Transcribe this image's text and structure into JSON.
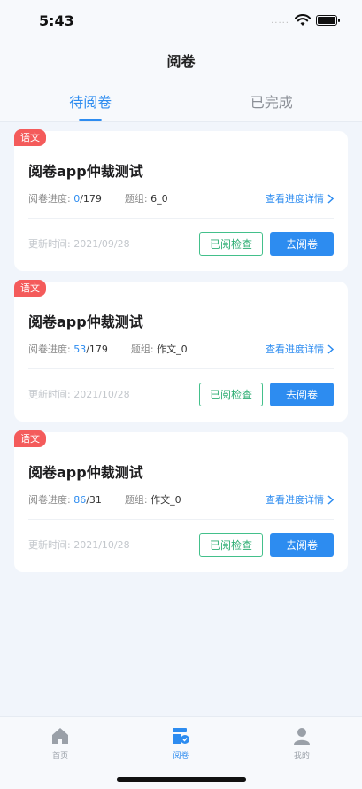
{
  "status_bar": {
    "time": "5:43",
    "signal": "....."
  },
  "nav": {
    "title": "阅卷"
  },
  "tabs": [
    {
      "label": "待阅卷",
      "active": true
    },
    {
      "label": "已完成",
      "active": false
    }
  ],
  "cards": [
    {
      "tag": "语文",
      "title": "阅卷app仲裁测试",
      "progress_label": "阅卷进度:",
      "progress_done": "0",
      "progress_total": "/179",
      "group_label": "题组:",
      "group_value": "6_0",
      "detail_link": "查看进度详情",
      "updated": "更新时间: 2021/09/28",
      "check_button": "已阅检查",
      "go_button": "去阅卷"
    },
    {
      "tag": "语文",
      "title": "阅卷app仲裁测试",
      "progress_label": "阅卷进度:",
      "progress_done": "53",
      "progress_total": "/179",
      "group_label": "题组:",
      "group_value": "作文_0",
      "detail_link": "查看进度详情",
      "updated": "更新时间: 2021/10/28",
      "check_button": "已阅检查",
      "go_button": "去阅卷"
    },
    {
      "tag": "语文",
      "title": "阅卷app仲裁测试",
      "progress_label": "阅卷进度:",
      "progress_done": "86",
      "progress_total": "/31",
      "group_label": "题组:",
      "group_value": "作文_0",
      "detail_link": "查看进度详情",
      "updated": "更新时间: 2021/10/28",
      "check_button": "已阅检查",
      "go_button": "去阅卷"
    }
  ],
  "tabbar": [
    {
      "label": "首页",
      "icon": "home-icon",
      "active": false
    },
    {
      "label": "阅卷",
      "icon": "grading-icon",
      "active": true
    },
    {
      "label": "我的",
      "icon": "profile-icon",
      "active": false
    }
  ],
  "colors": {
    "accent": "#2d8cf0",
    "tag": "#f45b5b",
    "success": "#43c08b"
  }
}
